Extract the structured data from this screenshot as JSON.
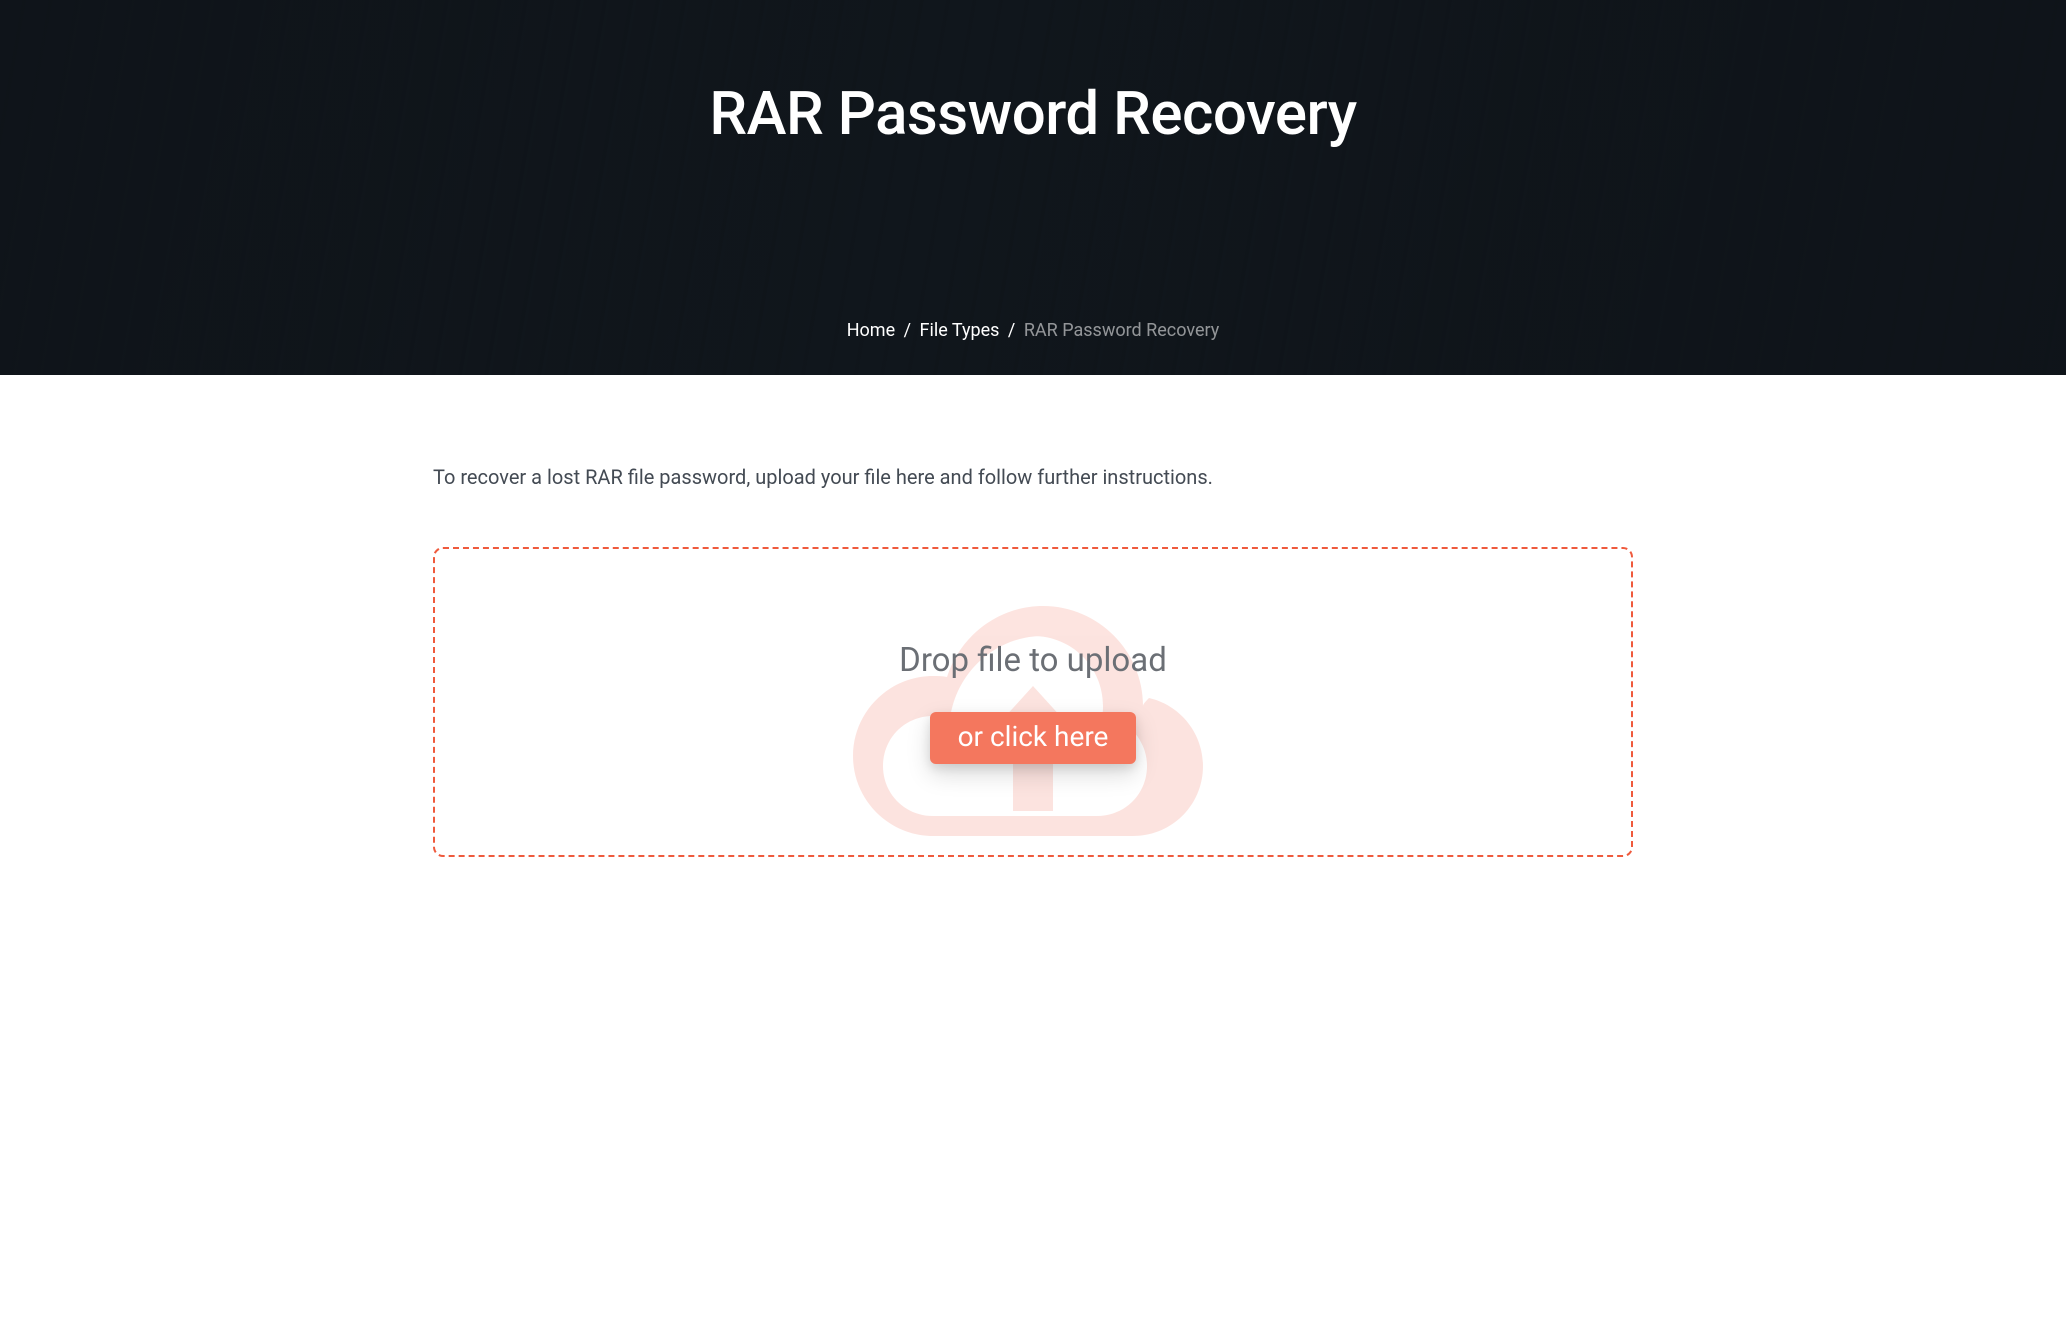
{
  "hero": {
    "title": "RAR Password Recovery"
  },
  "breadcrumb": {
    "home": "Home",
    "file_types": "File Types",
    "current": "RAR Password Recovery",
    "sep": "/"
  },
  "intro_text": "To recover a lost RAR file password, upload your file here and follow further instructions.",
  "dropzone": {
    "drop_text": "Drop file to upload",
    "click_label": "or click here"
  },
  "colors": {
    "accent": "#ef5a3d",
    "button": "#f4775e"
  }
}
